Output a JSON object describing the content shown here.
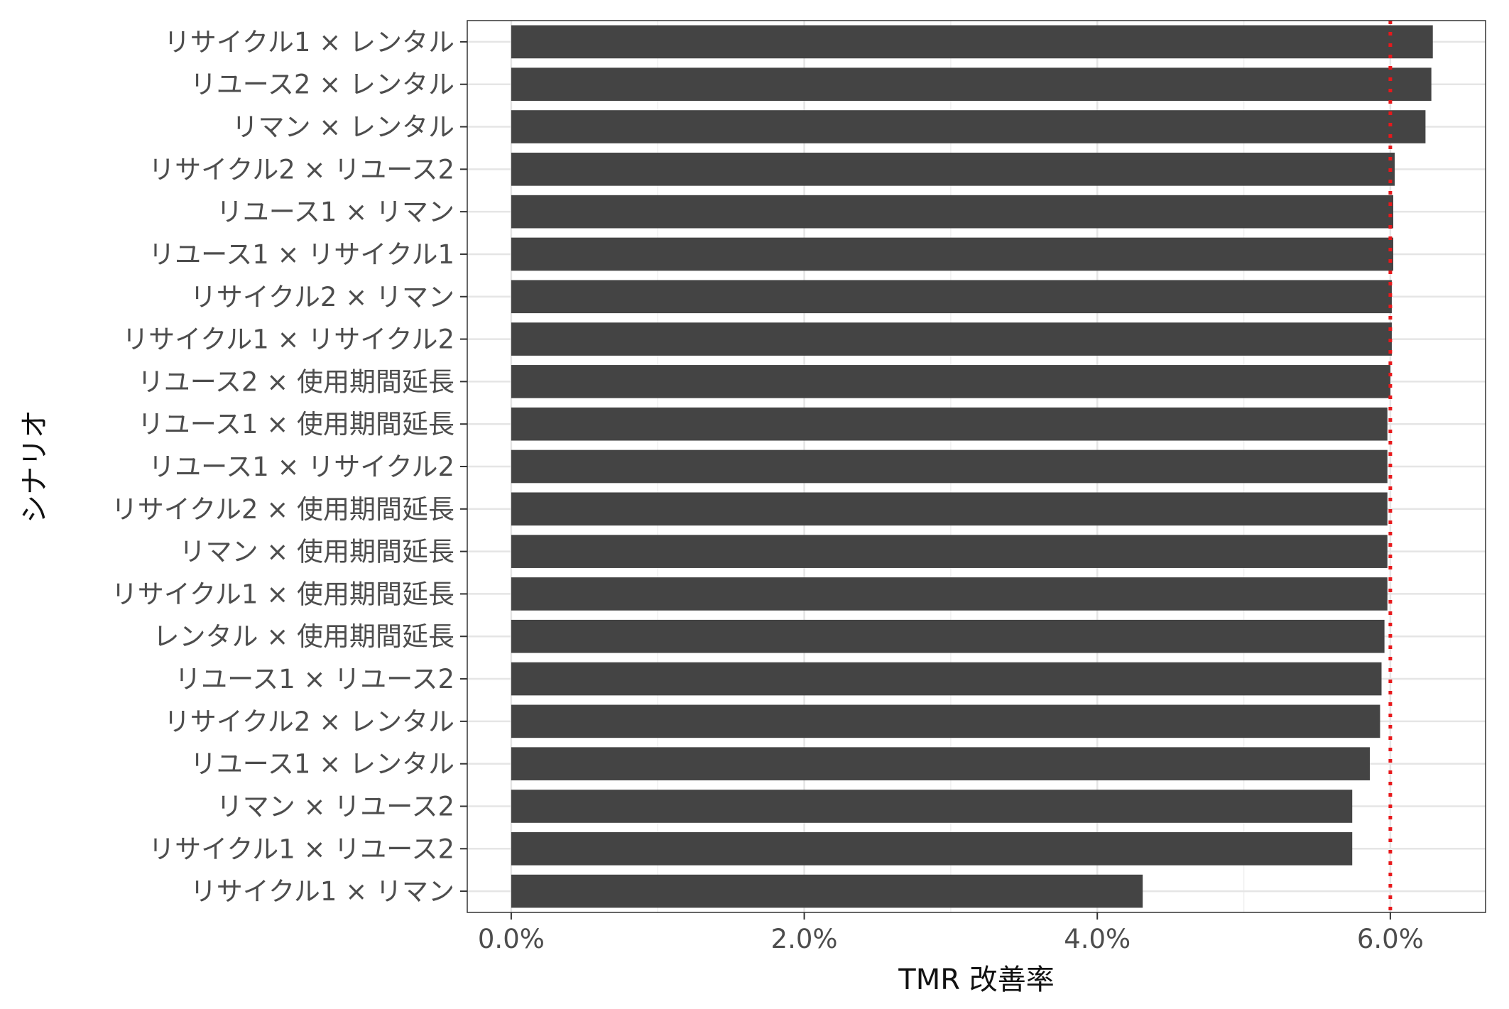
{
  "chart_data": {
    "type": "bar",
    "orientation": "horizontal",
    "title": "",
    "xlabel": "TMR 改善率",
    "ylabel": "シナリオ",
    "xlim": [
      -0.003,
      0.0665
    ],
    "x_ticks": [
      0.0,
      0.02,
      0.04,
      0.06
    ],
    "x_tick_labels": [
      "0.0%",
      "2.0%",
      "4.0%",
      "6.0%"
    ],
    "grid": true,
    "legend": "none",
    "bar_color": "#444444",
    "reference_line": {
      "value": 0.06,
      "style": "dotted",
      "color": "#e8181b"
    },
    "categories": [
      "リサイクル1 × レンタル",
      "リユース2 × レンタル",
      "リマン × レンタル",
      "リサイクル2 × リユース2",
      "リユース1 × リマン",
      "リユース1 × リサイクル1",
      "リサイクル2 × リマン",
      "リサイクル1 × リサイクル2",
      "リユース2 × 使用期間延長",
      "リユース1 × 使用期間延長",
      "リユース1 × リサイクル2",
      "リサイクル2 × 使用期間延長",
      "リマン × 使用期間延長",
      "リサイクル1 × 使用期間延長",
      "レンタル × 使用期間延長",
      "リユース1 × リユース2",
      "リサイクル2 × レンタル",
      "リユース1 × レンタル",
      "リマン × リユース2",
      "リサイクル1 × リユース2",
      "リサイクル1 × リマン"
    ],
    "values": [
      0.0629,
      0.0628,
      0.0624,
      0.0603,
      0.0602,
      0.0602,
      0.0601,
      0.0601,
      0.06,
      0.0598,
      0.0598,
      0.0598,
      0.0598,
      0.0598,
      0.0596,
      0.0594,
      0.0593,
      0.0586,
      0.0574,
      0.0574,
      0.0431
    ]
  }
}
